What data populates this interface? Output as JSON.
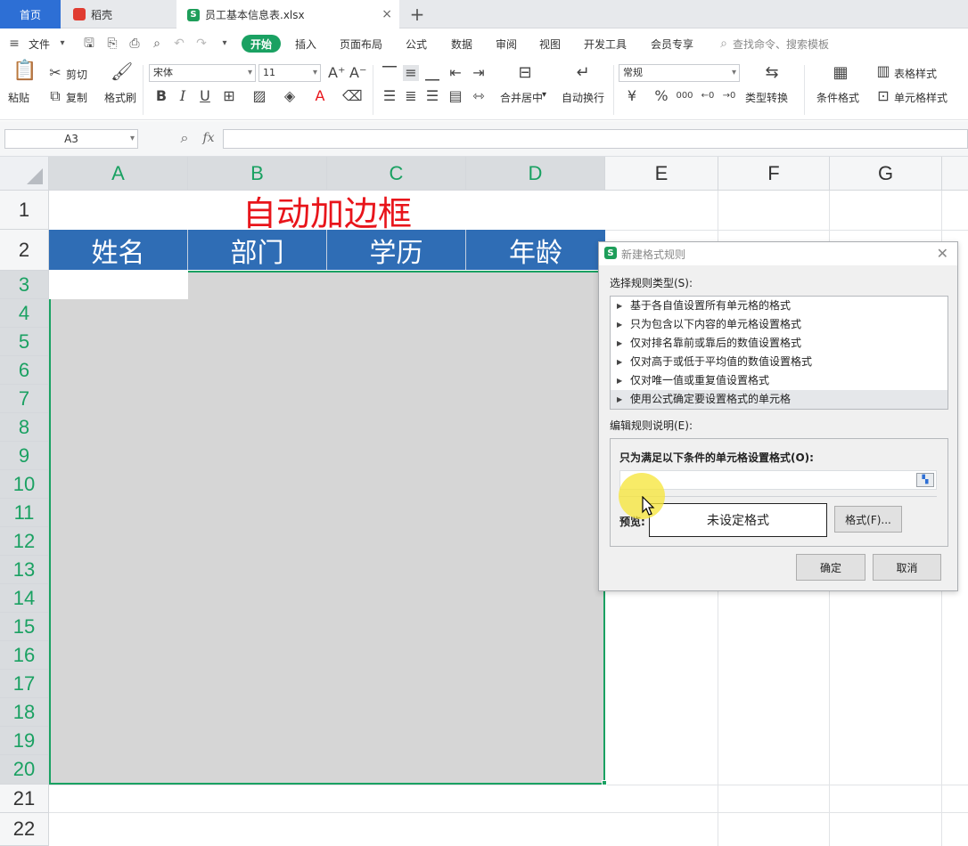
{
  "tabs": {
    "home": "首页",
    "daoke": "稻壳",
    "file": "员工基本信息表.xlsx",
    "add": "+",
    "close": "×"
  },
  "menu": {
    "file": "文件",
    "start": "开始",
    "insert": "插入",
    "layout": "页面布局",
    "formula": "公式",
    "data": "数据",
    "review": "审阅",
    "view": "视图",
    "dev": "开发工具",
    "member": "会员专享",
    "search": "查找命令、搜索模板"
  },
  "ribbon": {
    "paste": "粘贴",
    "cut": "剪切",
    "copy": "复制",
    "format_painter": "格式刷",
    "font_name": "宋体",
    "font_size": "11",
    "bold": "B",
    "italic": "I",
    "underline": "U",
    "merge_center": "合并居中",
    "auto_wrap": "自动换行",
    "number_format": "常规",
    "type_convert": "类型转换",
    "cond_format": "条件格式",
    "table_style": "表格样式",
    "cell_style": "单元格样式",
    "currency": "¥",
    "percent": "%",
    "thousands": "000"
  },
  "formula_bar": {
    "cell_ref": "A3",
    "fx": "fx"
  },
  "sheet": {
    "columns": [
      "A",
      "B",
      "C",
      "D",
      "E",
      "F",
      "G"
    ],
    "rows": [
      "1",
      "2",
      "3",
      "4",
      "5",
      "6",
      "7",
      "8",
      "9",
      "10",
      "11",
      "12",
      "13",
      "14",
      "15",
      "16",
      "17",
      "18",
      "19",
      "20",
      "21",
      "22"
    ],
    "title": "自动加边框",
    "headers": [
      "姓名",
      "部门",
      "学历",
      "年龄"
    ]
  },
  "dialog": {
    "title": "新建格式规则",
    "select_type_label": "选择规则类型(S):",
    "rule_types": [
      "基于各自值设置所有单元格的格式",
      "只为包含以下内容的单元格设置格式",
      "仅对排名靠前或靠后的数值设置格式",
      "仅对高于或低于平均值的数值设置格式",
      "仅对唯一值或重复值设置格式",
      "使用公式确定要设置格式的单元格"
    ],
    "edit_label": "编辑规则说明(E):",
    "condition_label": "只为满足以下条件的单元格设置格式(O):",
    "preview_label": "预览:",
    "preview_text": "未设定格式",
    "format_button": "格式(F)...",
    "ok": "确定",
    "cancel": "取消"
  },
  "colors": {
    "accent_green": "#1aa162",
    "header_blue": "#2f6db5",
    "title_red": "#e8151b",
    "home_tab_blue": "#2d6fd5"
  }
}
